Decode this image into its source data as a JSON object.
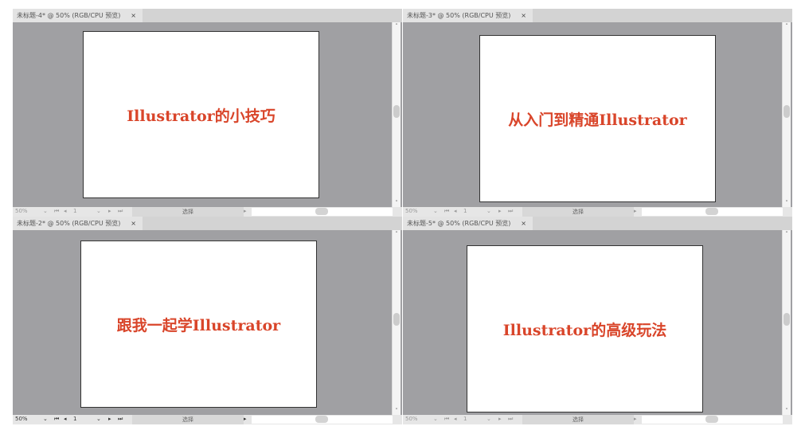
{
  "panels": [
    {
      "tab": "未标题-4* @ 50% (RGB/CPU 预览)",
      "text": "Illustrator的小技巧",
      "zoom": "50%",
      "page": "1",
      "mode": "选择"
    },
    {
      "tab": "未标题-3* @ 50% (RGB/CPU 预览)",
      "text": "从入门到精通Illustrator",
      "zoom": "50%",
      "page": "1",
      "mode": "选择"
    },
    {
      "tab": "未标题-2* @ 50% (RGB/CPU 预览)",
      "text": "跟我一起学Illustrator",
      "zoom": "50%",
      "page": "1",
      "mode": "选择"
    },
    {
      "tab": "未标题-5* @ 50% (RGB/CPU 预览)",
      "text": "Illustrator的高级玩法",
      "zoom": "50%",
      "page": "1",
      "mode": "选择"
    }
  ],
  "close": "×",
  "colors": {
    "accent": "#d9452a"
  }
}
